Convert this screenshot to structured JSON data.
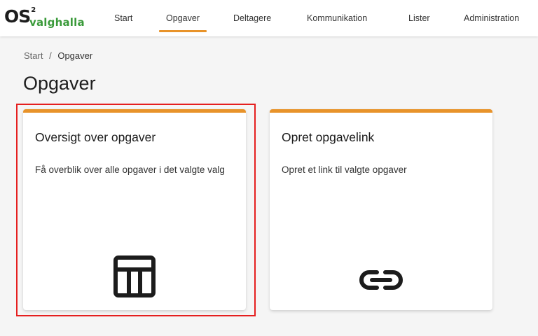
{
  "app": {
    "logo_main": "OS",
    "logo_sup": "2",
    "logo_name": "valghalla"
  },
  "nav": {
    "items": [
      {
        "label": "Start",
        "active": false
      },
      {
        "label": "Opgaver",
        "active": true
      },
      {
        "label": "Deltagere",
        "active": false
      },
      {
        "label": "Kommunikation",
        "active": false
      },
      {
        "label": "Lister",
        "active": false
      },
      {
        "label": "Administration",
        "active": false
      }
    ]
  },
  "breadcrumb": {
    "items": [
      "Start",
      "Opgaver"
    ],
    "separator": "/"
  },
  "page": {
    "title": "Opgaver"
  },
  "cards": [
    {
      "title": "Oversigt over opgaver",
      "description": "Få overblik over alle opgaver i det valgte valg",
      "icon": "table-icon"
    },
    {
      "title": "Opret opgavelink",
      "description": "Opret et link til valgte opgaver",
      "icon": "link-icon"
    }
  ],
  "colors": {
    "accent": "#e8932a",
    "brand_green": "#3a9a3a",
    "highlight": "#e51f1f"
  }
}
